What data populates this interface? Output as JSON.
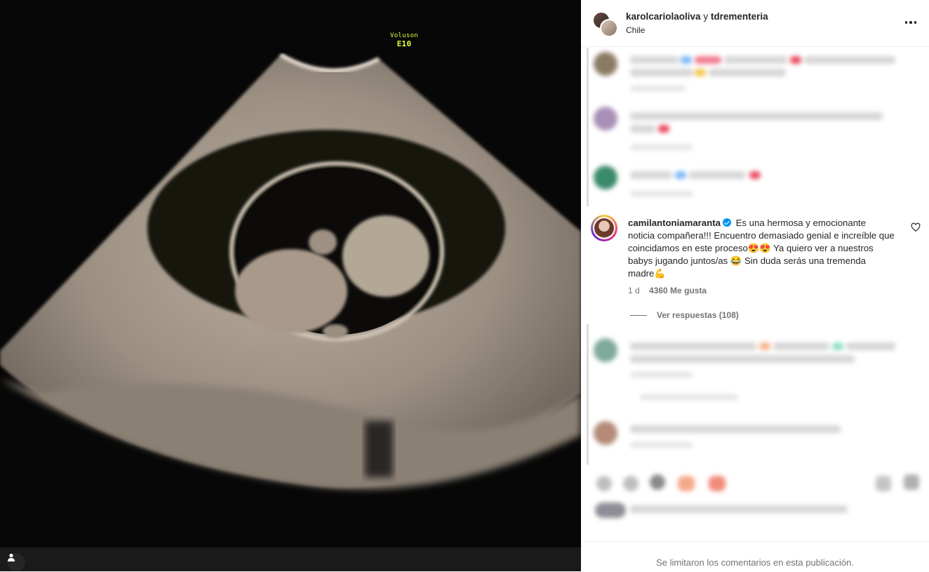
{
  "post": {
    "header": {
      "authors": "karolcariolaoliva",
      "coauthor_joiner": "y",
      "coauthor": "tdrementeria",
      "location": "Chile"
    },
    "media": {
      "scanner_brand": "Voluson",
      "scanner_model": "E10"
    },
    "featured_comment": {
      "username": "camilantoniamaranta",
      "text": "Es una hermosa y emocionante noticia compañera!!! Encuentro demasiado genial e increíble que coincidamos en este proceso😍😍 Ya quiero ver a nuestros babys jugando juntos/as 😂 Sin duda serás una tremenda madre💪",
      "age": "1 d",
      "likes": "4360 Me gusta",
      "replies": "Ver respuestas (108)"
    },
    "footer": {
      "notice": "Se limitaron los comentarios en esta publicación."
    }
  },
  "icons": {
    "more": "more-options-icon",
    "heart": "heart-icon",
    "tag": "user-tag-icon",
    "verified": "verified-badge-icon"
  },
  "colors": {
    "verified": "#0095f6",
    "scan_label": "#e6ff3a",
    "muted_text": "#737373"
  }
}
